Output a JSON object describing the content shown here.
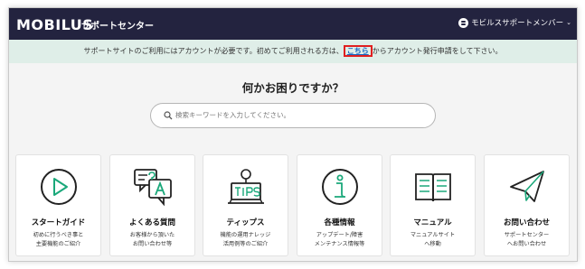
{
  "header": {
    "logo": "MOBILUS",
    "site_title": "サポートセンター",
    "user_label": "モビルスサポートメンバー",
    "user_caret": "⌄"
  },
  "notice": {
    "before": "サポートサイトのご利用にはアカウントが必要です。初めてご利用される方は、",
    "link": "こちら",
    "after": "からアカウント発行申請をして下さい。"
  },
  "main": {
    "heading": "何かお困りですか？",
    "search_placeholder": "検索キーワードを入力してください。"
  },
  "cards": [
    {
      "title": "スタートガイド",
      "desc1": "初めに行うべき事と",
      "desc2": "主要機能のご紹介",
      "icon": "play-circle-icon"
    },
    {
      "title": "よくある質問",
      "desc1": "お客様から頂いた",
      "desc2": "お問い合わせ等",
      "icon": "speech-bubbles-qa-icon"
    },
    {
      "title": "ティップス",
      "desc1": "機能の運用ナレッジ",
      "desc2": "活用例等のご紹介",
      "icon": "lightbulb-tips-icon"
    },
    {
      "title": "各種情報",
      "desc1": "アップデート/障害",
      "desc2": "メンテナンス情報等",
      "icon": "info-circle-icon"
    },
    {
      "title": "マニュアル",
      "desc1": "マニュアルサイト",
      "desc2": "へ移動",
      "icon": "book-icon"
    },
    {
      "title": "お問い合わせ",
      "desc1": "サポートセンター",
      "desc2": "へお問い合わせ",
      "icon": "paper-plane-icon"
    }
  ],
  "colors": {
    "header_bg": "#23233f",
    "notice_bg": "#dfeee8",
    "link": "#1565c0",
    "highlight_box": "#e02020",
    "icon_stroke": "#222222"
  }
}
